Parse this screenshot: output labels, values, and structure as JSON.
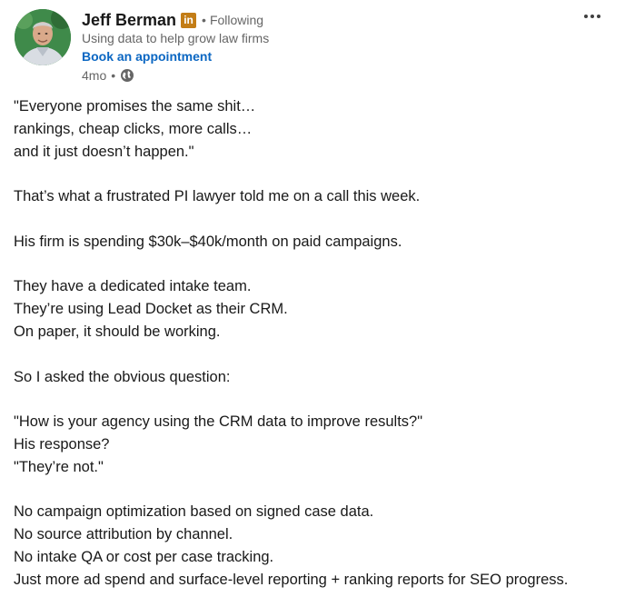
{
  "author": {
    "name": "Jeff Berman",
    "badge_icon": "linkedin-premium-icon",
    "follow_status": "Following",
    "headline": "Using data to help grow law firms",
    "cta": "Book an appointment",
    "time": "4mo",
    "visibility_icon": "globe-icon"
  },
  "colors": {
    "link": "#0a66c2",
    "text": "#191919",
    "muted": "#666666",
    "badge": "#c37d16"
  },
  "post": {
    "lines": [
      "\"Everyone promises the same shit…",
      "rankings, cheap clicks, more calls…",
      "and it just doesn’t happen.\"",
      "",
      "That’s what a frustrated PI lawyer told me on a call this week.",
      "",
      "His firm is spending $30k–$40k/month on paid campaigns.",
      "",
      "They have a dedicated intake team.",
      "They’re using Lead Docket as their CRM.",
      "On paper, it should be working.",
      "",
      "So I asked the obvious question:",
      "",
      "\"How is your agency using the CRM data to improve results?\"",
      "His response?",
      "\"They’re not.\"",
      "",
      "No campaign optimization based on signed case data.",
      "No source attribution by channel.",
      "No intake QA or cost per case tracking.",
      "Just more ad spend and surface-level reporting + ranking reports for SEO progress."
    ]
  },
  "menu": {
    "icon": "more-options-icon"
  }
}
